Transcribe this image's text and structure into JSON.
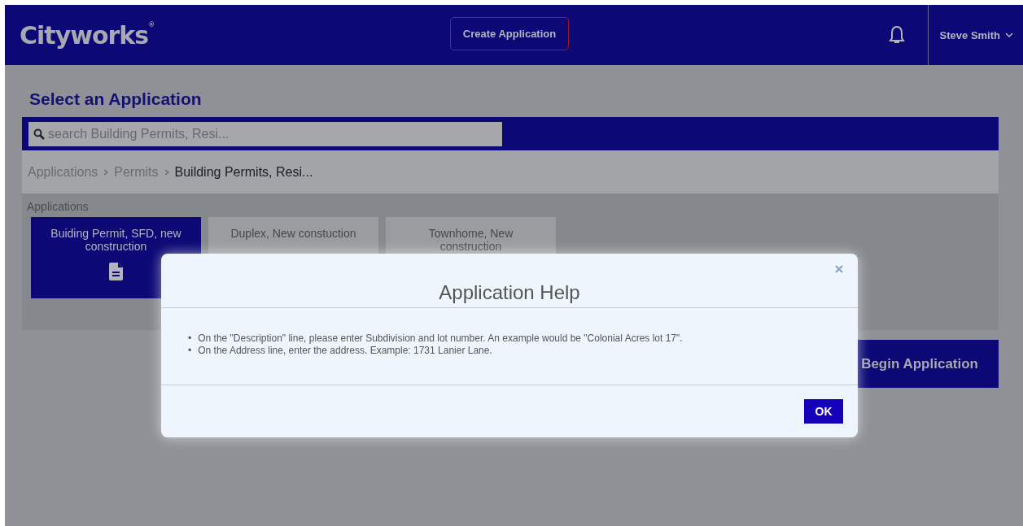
{
  "header": {
    "logo": "Cityworks",
    "logo_mark": "®",
    "create_button": "Create Application",
    "user": "Steve Smith"
  },
  "page_title": "Select an Application",
  "search": {
    "placeholder": "search Building Permits, Resi..."
  },
  "breadcrumb": [
    {
      "label": "Applications",
      "current": false
    },
    {
      "label": "Permits",
      "current": false
    },
    {
      "label": "Building Permits, Resi...",
      "current": true
    }
  ],
  "applications": {
    "label": "Applications",
    "tiles": [
      {
        "label": "Buiding Permit, SFD, new construction",
        "selected": true
      },
      {
        "label": "Duplex, New constuction",
        "selected": false
      },
      {
        "label": "Townhome, New construction",
        "selected": false
      }
    ]
  },
  "begin_button": "Begin Application",
  "modal": {
    "title": "Application Help",
    "bullets": [
      {
        "marker": "•",
        "text": "On the \"Description\" line, please enter Subdivision and lot number. An example would be \"Colonial Acres lot 17\"."
      },
      {
        "marker": "•",
        "text": "On the Address line, enter the address. Example: 1731 Lanier Lane."
      }
    ],
    "ok": "OK"
  }
}
